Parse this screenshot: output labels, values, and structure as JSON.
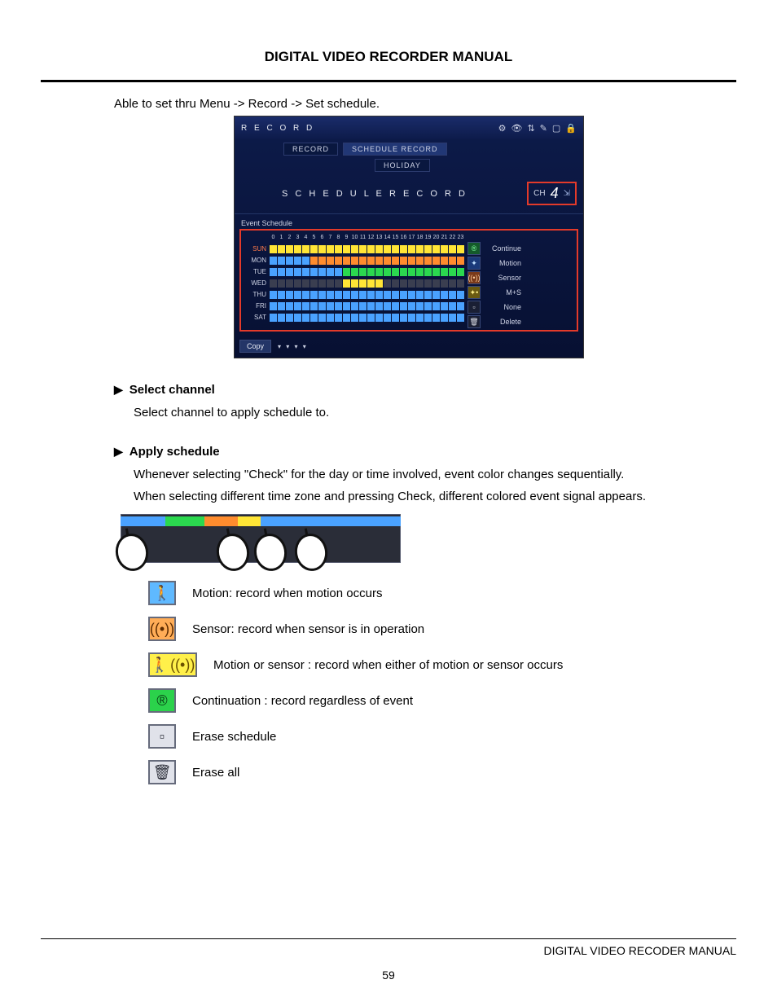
{
  "doc_title": "DIGITAL VIDEO RECORDER MANUAL",
  "intro_line": "Able to set thru Menu -> Record -> Set schedule.",
  "screenshot": {
    "header_title": "R E C O R D",
    "header_icons": [
      "gear-icon",
      "eye-icon",
      "network-icon",
      "pencil-icon",
      "monitor-icon",
      "lock-icon"
    ],
    "tabs": {
      "record": "RECORD",
      "schedule_record": "SCHEDULE RECORD",
      "holiday": "HOLIDAY"
    },
    "subtitle": "S C H E D U L E   R E C O R D",
    "channel_label": "CH",
    "channel_value": "4",
    "event_schedule_label": "Event Schedule",
    "hours": [
      "0",
      "1",
      "2",
      "3",
      "4",
      "5",
      "6",
      "7",
      "8",
      "9",
      "10",
      "11",
      "12",
      "13",
      "14",
      "15",
      "16",
      "17",
      "18",
      "19",
      "20",
      "21",
      "22",
      "23"
    ],
    "days": [
      "SUN",
      "MON",
      "TUE",
      "WED",
      "THU",
      "FRI",
      "SAT"
    ],
    "grid": {
      "SUN": [
        "ms",
        "ms",
        "ms",
        "ms",
        "ms",
        "ms",
        "ms",
        "ms",
        "ms",
        "ms",
        "ms",
        "ms",
        "ms",
        "ms",
        "ms",
        "ms",
        "ms",
        "ms",
        "ms",
        "ms",
        "ms",
        "ms",
        "ms",
        "ms"
      ],
      "MON": [
        "mot",
        "mot",
        "mot",
        "mot",
        "mot",
        "sen",
        "sen",
        "sen",
        "sen",
        "sen",
        "sen",
        "sen",
        "sen",
        "sen",
        "sen",
        "sen",
        "sen",
        "sen",
        "sen",
        "sen",
        "sen",
        "sen",
        "sen",
        "sen"
      ],
      "TUE": [
        "mot",
        "mot",
        "mot",
        "mot",
        "mot",
        "mot",
        "mot",
        "mot",
        "mot",
        "cont",
        "cont",
        "cont",
        "cont",
        "cont",
        "cont",
        "cont",
        "cont",
        "cont",
        "cont",
        "cont",
        "cont",
        "cont",
        "cont",
        "cont"
      ],
      "WED": [
        "none",
        "none",
        "none",
        "none",
        "none",
        "none",
        "none",
        "none",
        "none",
        "ms",
        "ms",
        "ms",
        "ms",
        "ms",
        "none",
        "none",
        "none",
        "none",
        "none",
        "none",
        "none",
        "none",
        "none",
        "none"
      ],
      "THU": [
        "mot",
        "mot",
        "mot",
        "mot",
        "mot",
        "mot",
        "mot",
        "mot",
        "mot",
        "mot",
        "mot",
        "mot",
        "mot",
        "mot",
        "mot",
        "mot",
        "mot",
        "mot",
        "mot",
        "mot",
        "mot",
        "mot",
        "mot",
        "mot"
      ],
      "FRI": [
        "mot",
        "mot",
        "mot",
        "mot",
        "mot",
        "mot",
        "mot",
        "mot",
        "mot",
        "mot",
        "mot",
        "mot",
        "mot",
        "mot",
        "mot",
        "mot",
        "mot",
        "mot",
        "mot",
        "mot",
        "mot",
        "mot",
        "mot",
        "mot"
      ],
      "SAT": [
        "mot",
        "mot",
        "mot",
        "mot",
        "mot",
        "mot",
        "mot",
        "mot",
        "mot",
        "mot",
        "mot",
        "mot",
        "mot",
        "mot",
        "mot",
        "mot",
        "mot",
        "mot",
        "mot",
        "mot",
        "mot",
        "mot",
        "mot",
        "mot"
      ]
    },
    "legend": {
      "continue": "Continue",
      "motion": "Motion",
      "sensor": "Sensor",
      "ms": "M+S",
      "none": "None",
      "delete": "Delete"
    },
    "copy_button": "Copy"
  },
  "section1": {
    "heading": "Select channel",
    "body": "Select channel to apply schedule to."
  },
  "section2": {
    "heading": "Apply schedule",
    "body1": "Whenever selecting \"Check\" for the day or time involved, event color changes sequentially.",
    "body2": "When selecting different time zone and pressing Check, different colored event signal appears."
  },
  "strip_segments": [
    {
      "from": 0,
      "to": 0.16,
      "cls": "c-mot"
    },
    {
      "from": 0.16,
      "to": 0.3,
      "cls": "c-cont"
    },
    {
      "from": 0.3,
      "to": 0.42,
      "cls": "c-sen"
    },
    {
      "from": 0.42,
      "to": 0.5,
      "cls": "c-ms"
    },
    {
      "from": 0.5,
      "to": 1.0,
      "cls": "c-mot"
    }
  ],
  "legend_list": [
    {
      "icon": "motion-icon",
      "text": "Motion: record when motion occurs"
    },
    {
      "icon": "sensor-icon",
      "text": "Sensor: record when sensor is in operation"
    },
    {
      "icon": "motion-sensor-icon",
      "text": "Motion or sensor : record when either of motion or sensor occurs"
    },
    {
      "icon": "continuation-icon",
      "text": "Continuation : record regardless of event"
    },
    {
      "icon": "erase-schedule-icon",
      "text": "Erase schedule"
    },
    {
      "icon": "erase-all-icon",
      "text": "Erase all"
    }
  ],
  "footer_right": "DIGITAL VIDEO RECODER MANUAL",
  "page_number": "59"
}
